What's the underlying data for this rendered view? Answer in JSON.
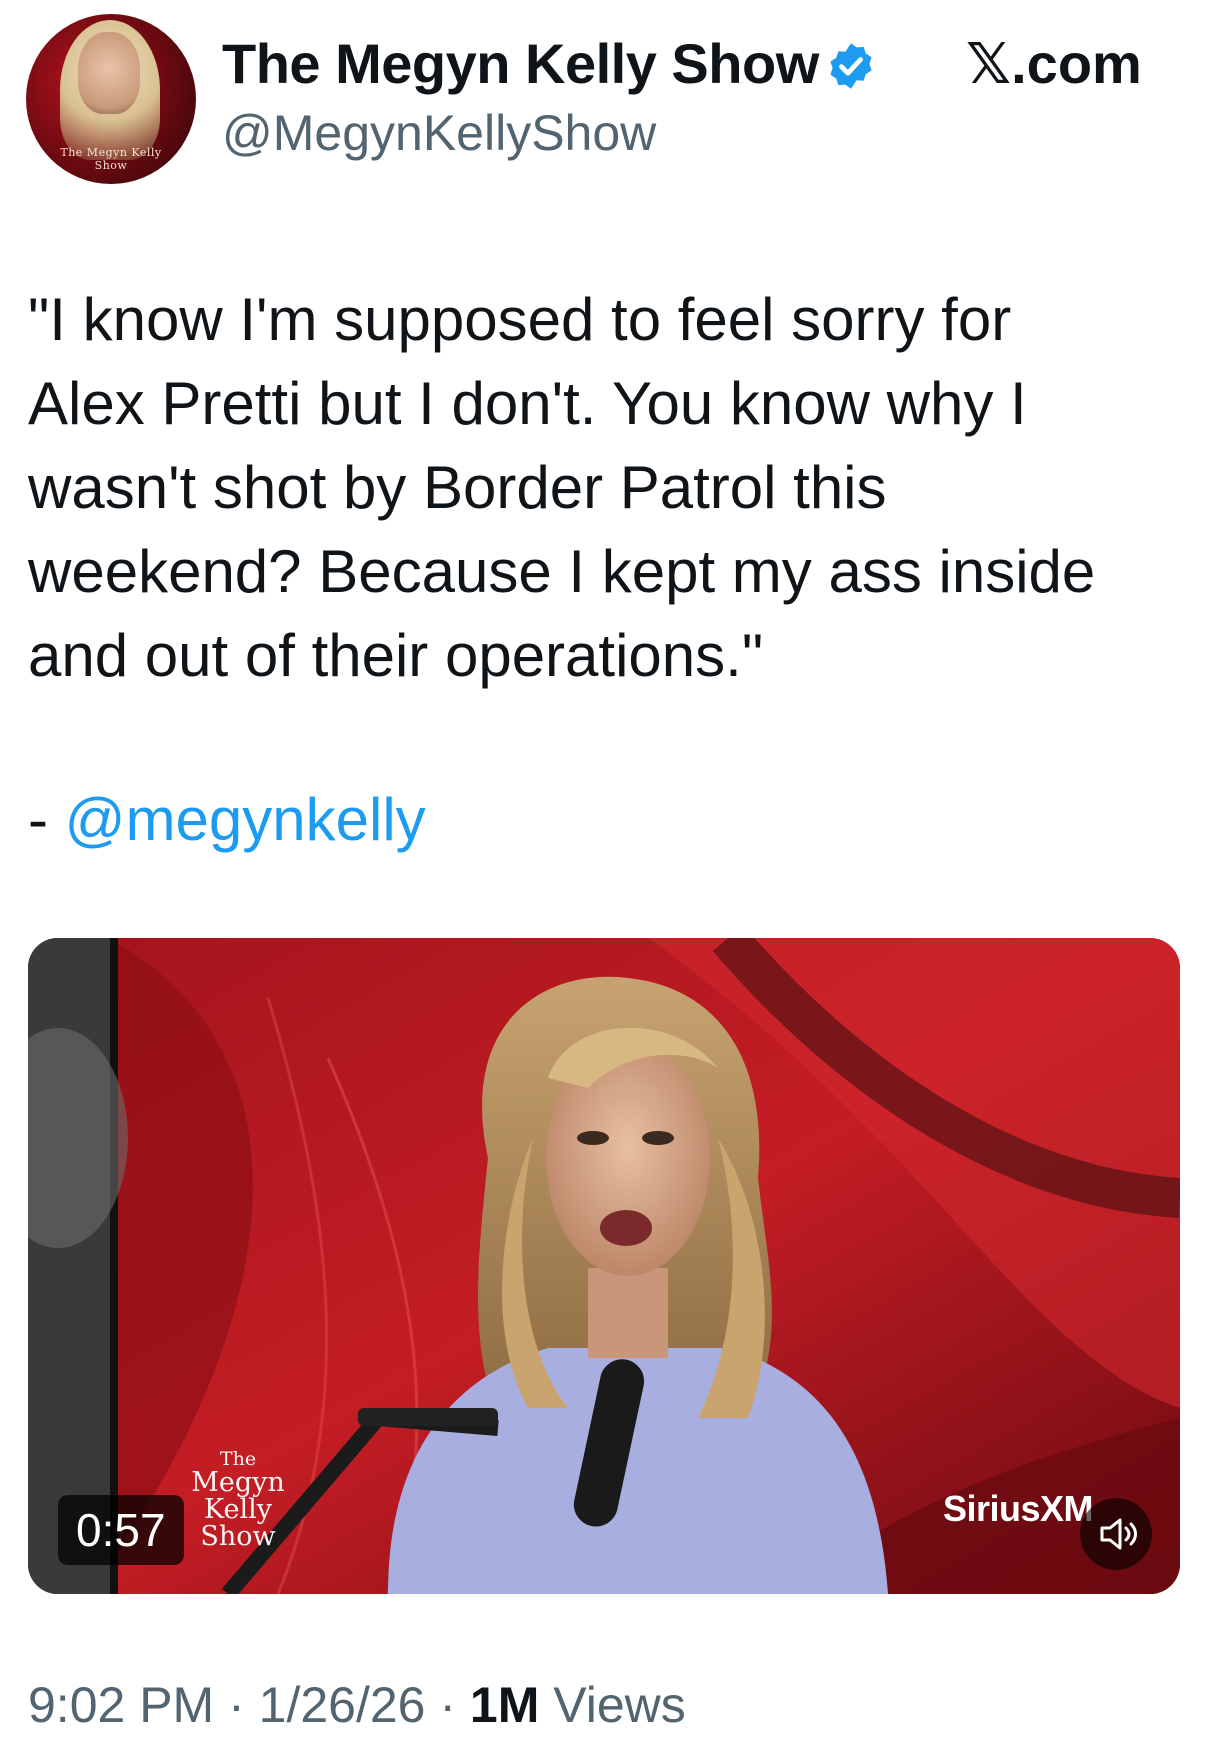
{
  "header": {
    "avatar_caption": "The Megyn Kelly Show",
    "display_name": "The Megyn Kelly Show",
    "handle": "@MegynKellyShow",
    "brand": "𝕏.com"
  },
  "tweet": {
    "text": "\"I know I'm supposed to feel sorry for\nAlex Pretti but I don't. You know why I\nwasn't shot by Border Patrol this\nweekend? Because I kept my ass inside\nand out of their operations.\"",
    "attribution_prefix": "- ",
    "mention": "@megynkelly"
  },
  "video": {
    "duration": "0:57",
    "logo_lines": [
      "The",
      "Megyn",
      "Kelly",
      "Show"
    ],
    "watermark": "SiriusXM"
  },
  "footer": {
    "time": "9:02 PM",
    "sep1": " · ",
    "date": "1/26/26",
    "sep2": " · ",
    "views_count": "1M",
    "views_label": " Views"
  },
  "colors": {
    "link": "#1d9bf0",
    "verified": "#1d9bf0",
    "secondary_text": "#536471"
  }
}
